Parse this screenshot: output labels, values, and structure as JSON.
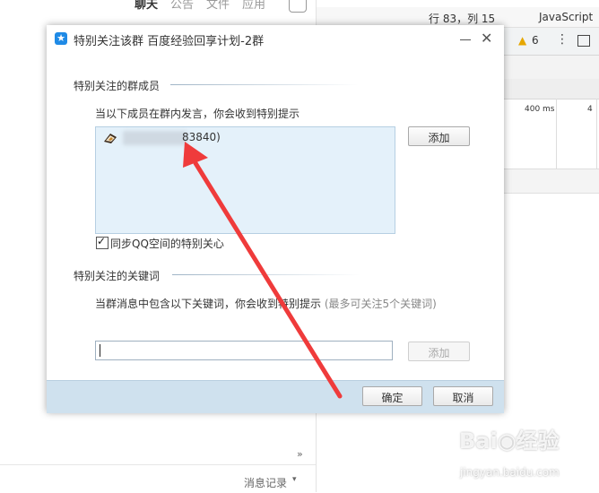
{
  "background": {
    "tabs": [
      "聊天",
      "公告",
      "文件",
      "应用"
    ],
    "active_tab": 0,
    "footer_label": "消息记录",
    "footer_caret": "▾",
    "collapse_glyph": "»",
    "cursor_pos": "行 83，列 15",
    "language": "JavaScript",
    "warning_count": "6",
    "timing": "400 ms",
    "timing_cut": "4"
  },
  "dialog": {
    "title": "特别关注该群 百度经验回享计划-2群",
    "logo_glyph": "★",
    "close_glyph": "✕",
    "members_section": {
      "heading": "特别关注的群成员",
      "hint": "当以下成员在群内发言，你会收到特别提示",
      "members": [
        {
          "qq_suffix": "83840)"
        }
      ],
      "add_button": "添加",
      "sync_label": "同步QQ空间的特别关心",
      "sync_checked": true
    },
    "keywords_section": {
      "heading": "特别关注的关键词",
      "hint": "当群消息中包含以下关键词，你会收到特别提示",
      "hint_extra": "(最多可关注5个关键词)",
      "input_value": "",
      "add_button": "添加"
    },
    "ok_button": "确定",
    "cancel_button": "取消"
  },
  "watermark": {
    "brand": "Bai◉经验",
    "url": "jingyan.baidu.com"
  },
  "colors": {
    "accent": "#1f8ae6",
    "arrow": "#ef3b3b",
    "list_bg": "#e4f1fa",
    "footer_bg": "#cfe1ee"
  }
}
